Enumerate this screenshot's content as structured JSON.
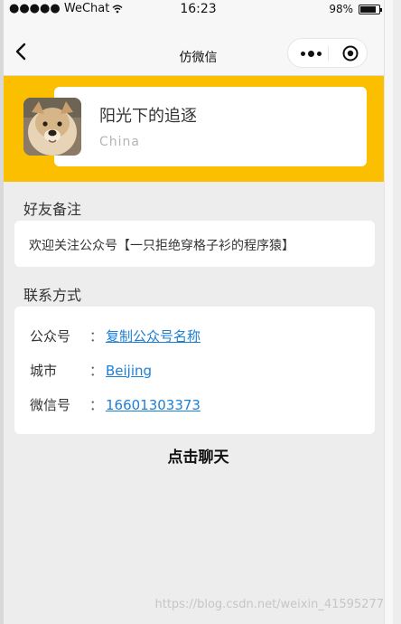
{
  "status_bar": {
    "signal": "●●●●● WeChat",
    "time": "16:23",
    "battery": "98%"
  },
  "nav": {
    "title": "仿微信"
  },
  "profile": {
    "name": "阳光下的追逐",
    "country": "China"
  },
  "remark": {
    "label": "好友备注",
    "text": "欢迎关注公众号【一只拒绝穿格子衫的程序猿】"
  },
  "contact": {
    "label": "联系方式",
    "items": [
      {
        "label": "公众号",
        "colon": "：",
        "value": "复制公众号名称"
      },
      {
        "label": "城市",
        "colon": "：",
        "value": "Beijing"
      },
      {
        "label": "微信号",
        "colon": "：",
        "value": "16601303373"
      }
    ]
  },
  "chat_button": "点击聊天",
  "watermark": "https://blog.csdn.net/weixin_41595277",
  "colors": {
    "accent": "#fbbf00",
    "link": "#1b7fd6",
    "background": "#ededed"
  }
}
